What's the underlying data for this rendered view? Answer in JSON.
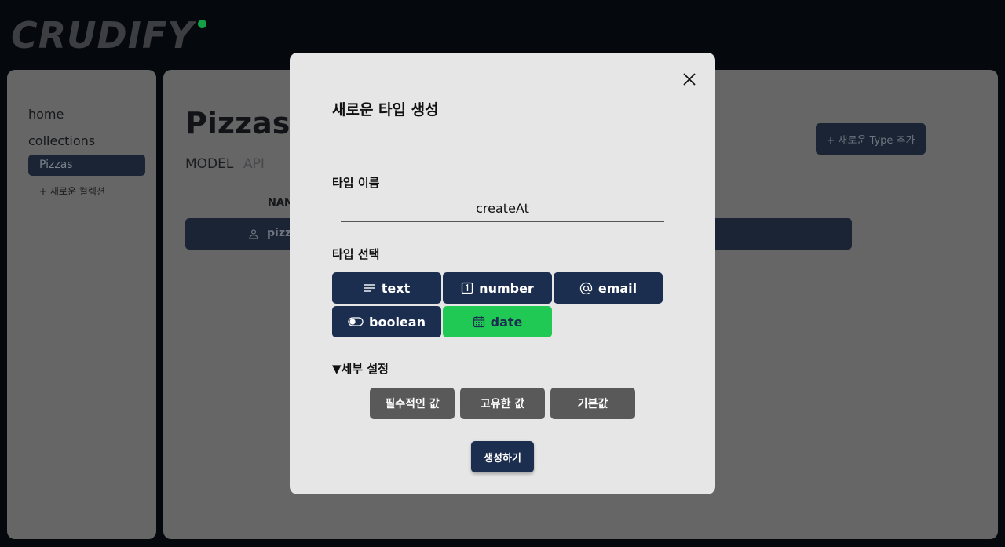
{
  "app": {
    "logo": "CRUDIFY"
  },
  "sidebar": {
    "home": "home",
    "collections": "collections",
    "active_collection": "Pizzas",
    "add_collection": "+ 새로운 컬렉션"
  },
  "main": {
    "title": "Pizzas",
    "tabs": [
      {
        "label": "MODEL"
      },
      {
        "label": "API"
      }
    ],
    "add_type_button": "+ 새로운 Type 추가",
    "column_header": "NAM",
    "row_value": "pizz"
  },
  "modal": {
    "title": "새로운 타입 생성",
    "name_label": "타입 이름",
    "name_value": "createAt",
    "type_label": "타입 선택",
    "types": [
      {
        "label": "text",
        "icon": "lines-icon"
      },
      {
        "label": "number",
        "icon": "number-box-icon"
      },
      {
        "label": "email",
        "icon": "at-icon"
      },
      {
        "label": "boolean",
        "icon": "toggle-icon"
      },
      {
        "label": "date",
        "icon": "calendar-icon",
        "selected": true
      }
    ],
    "details_toggle": "▼세부 설정",
    "options": [
      {
        "label": "필수적인 값"
      },
      {
        "label": "고유한 값"
      },
      {
        "label": "기본값"
      }
    ],
    "create_button": "생성하기"
  },
  "colors": {
    "navy": "#1c2e4f",
    "green": "#20c954",
    "modal_bg": "#e6e6e6",
    "option_gray": "#595959"
  }
}
